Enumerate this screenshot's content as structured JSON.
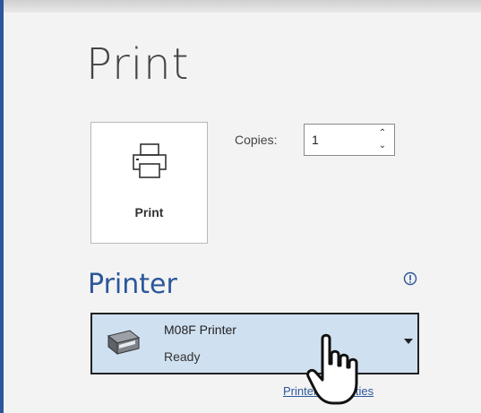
{
  "page": {
    "title": "Print"
  },
  "print_button": {
    "label": "Print",
    "icon": "printer-icon"
  },
  "copies": {
    "label": "Copies:",
    "value": "1"
  },
  "printer": {
    "section_title": "Printer",
    "selected_name": "M08F Printer",
    "selected_status": "Ready",
    "icon": "printer-device-icon"
  },
  "links": {
    "properties_label": "Printer Properties"
  },
  "colors": {
    "accent": "#2b579a",
    "selection": "#cfe0f0"
  }
}
